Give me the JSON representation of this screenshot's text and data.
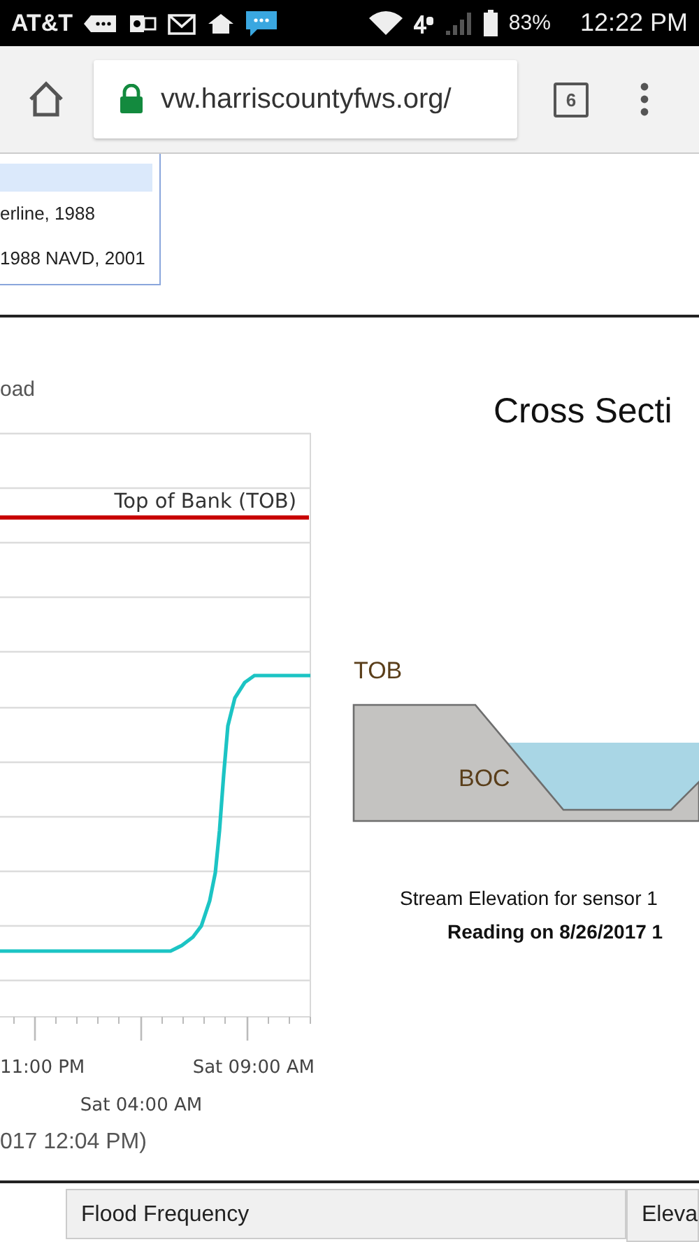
{
  "status_bar": {
    "carrier": "AT&T",
    "battery": "83%",
    "time": "12:22 PM"
  },
  "browser": {
    "url": "vw.harriscountyfws.org/",
    "tab_count": "6"
  },
  "legend": {
    "items": [
      "erline, 1988",
      "1988 NAVD, 2001"
    ]
  },
  "chart": {
    "title": "oad",
    "reference_label": "Top of Bank (TOB)",
    "x_labels": [
      "11:00 PM",
      "Sat 09:00 AM",
      "Sat 04:00 AM"
    ],
    "caption": "017 12:04 PM)"
  },
  "cross_section": {
    "title": "Cross Secti",
    "top_label": "TOB",
    "bottom_label": "BOC",
    "caption": "Stream Elevation for sensor 1",
    "reading": "Reading on 8/26/2017 1"
  },
  "table": {
    "columns": [
      "Flood Frequency",
      "Eleva"
    ]
  }
}
